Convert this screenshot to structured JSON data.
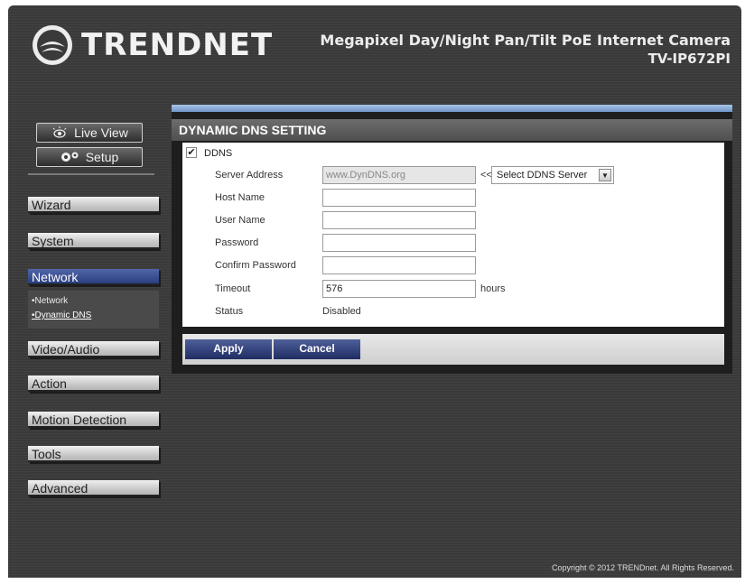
{
  "header": {
    "brand": "TRENDNET",
    "title_line1": "Megapixel Day/Night Pan/Tilt PoE Internet Camera",
    "title_line2": "TV-IP672PI"
  },
  "modes": {
    "live_view": "Live View",
    "setup": "Setup"
  },
  "nav": {
    "wizard": "Wizard",
    "system": "System",
    "network": "Network",
    "network_sub": {
      "network": "•Network",
      "dynamic_dns": "•Dynamic DNS"
    },
    "video_audio": "Video/Audio",
    "action": "Action",
    "motion_detection": "Motion Detection",
    "tools": "Tools",
    "advanced": "Advanced"
  },
  "ddns": {
    "section_title": "DYNAMIC DNS SETTING",
    "enable_label": "DDNS",
    "enabled": true,
    "server_address_label": "Server Address",
    "server_address_value": "www.DynDNS.org",
    "select_prefix": "<<",
    "select_value": "Select DDNS Server",
    "host_name_label": "Host Name",
    "host_name_value": "",
    "user_name_label": "User Name",
    "user_name_value": "",
    "password_label": "Password",
    "password_value": "",
    "confirm_password_label": "Confirm Password",
    "confirm_password_value": "",
    "timeout_label": "Timeout",
    "timeout_value": "576",
    "timeout_unit": "hours",
    "status_label": "Status",
    "status_value": "Disabled"
  },
  "buttons": {
    "apply": "Apply",
    "cancel": "Cancel"
  },
  "footer": {
    "copyright": "Copyright © 2012 TRENDnet. All Rights Reserved."
  }
}
